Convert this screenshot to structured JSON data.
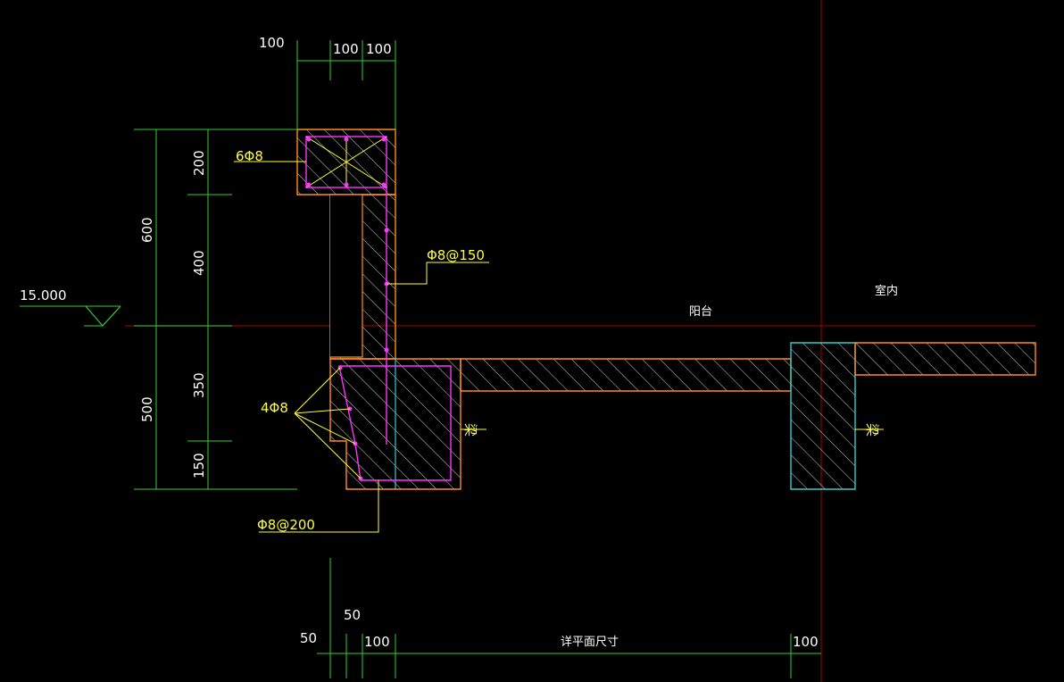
{
  "colors": {
    "background": "#000000",
    "dimension_line": "#33cc33",
    "outline": "#ff8c1a",
    "hatch": "#ffffff",
    "rebar": "#ff33ff",
    "leader": "#ffff33",
    "cyan": "#33cccc",
    "axis_red": "#8b0000"
  },
  "top_dims": {
    "d1": "100",
    "d2": "100",
    "d3": "100"
  },
  "left_dims": {
    "total_upper": "600",
    "total_lower": "500",
    "p1": "200",
    "p2": "400",
    "p3": "350",
    "p4": "150"
  },
  "elevation": {
    "value": "15.000"
  },
  "rebar_labels": {
    "top_corner": "6Φ8",
    "wall_stirrup": "Φ8@150",
    "beam_bars": "4Φ8",
    "beam_stirrup": "Φ8@200"
  },
  "room_labels": {
    "balcony": "阳台",
    "indoor": "室内"
  },
  "beam_marks": {
    "left": "梁",
    "right": "梁"
  },
  "bottom_dims": {
    "d50a": "50",
    "d50b": "50",
    "d100a": "100",
    "span": "详平面尺寸",
    "d100b": "100"
  }
}
